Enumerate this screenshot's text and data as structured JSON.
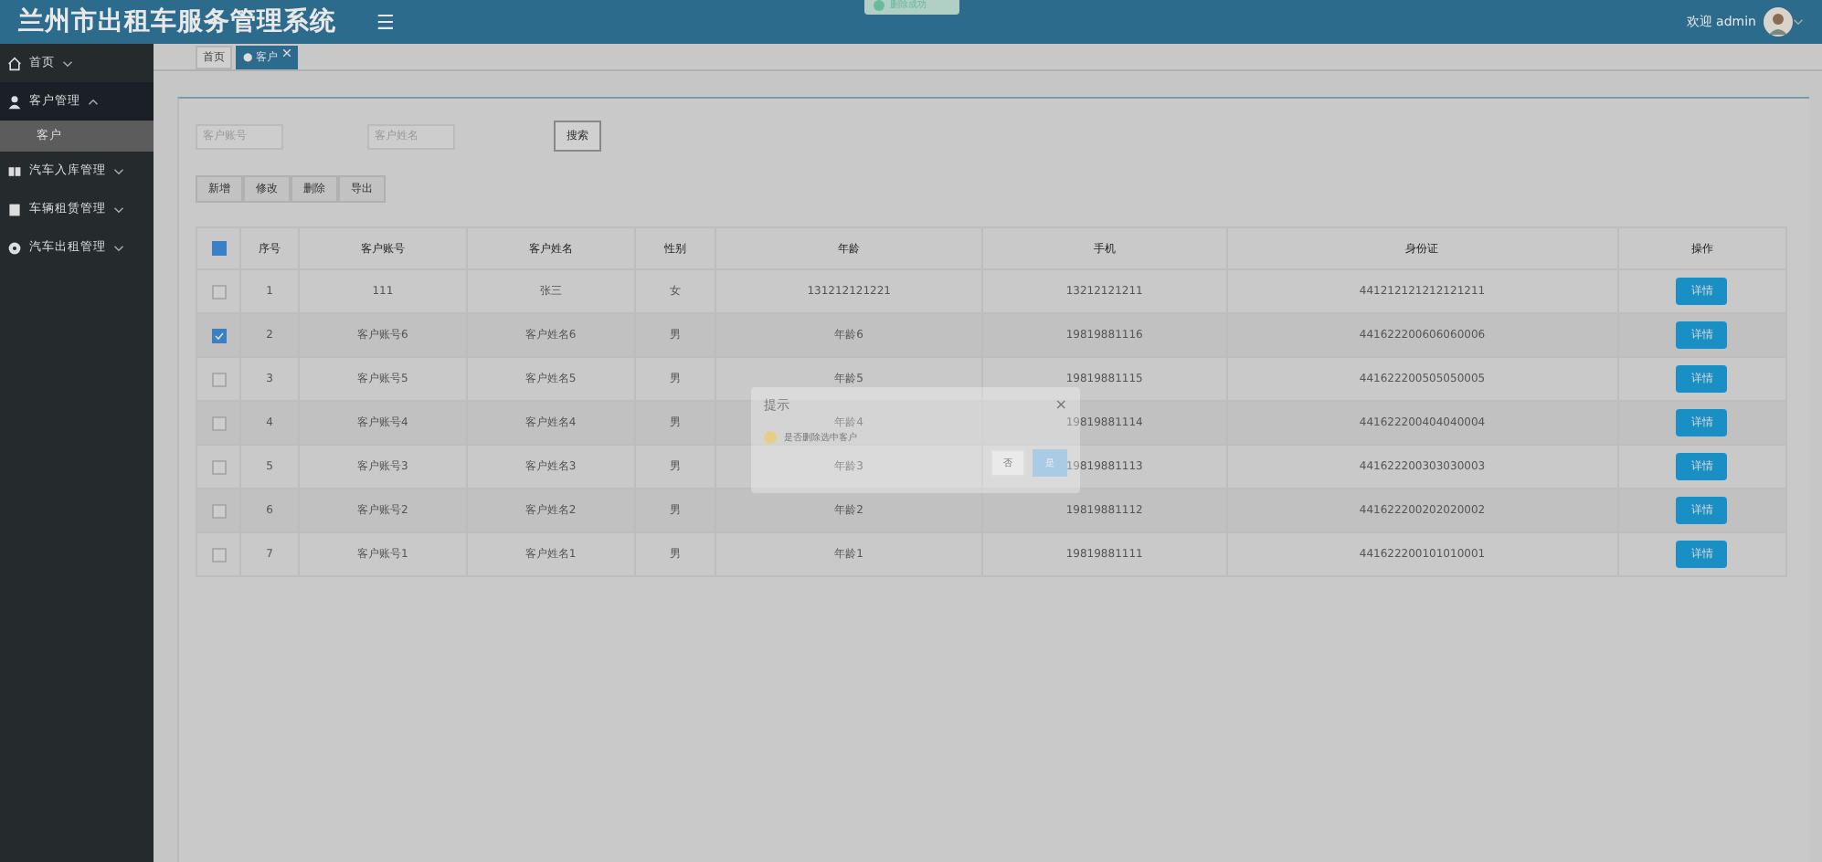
{
  "header": {
    "title": "兰州市出租车服务管理系统",
    "menu_toggle": "☰",
    "welcome": "欢迎 admin"
  },
  "toast": {
    "text": "删除成功"
  },
  "sidebar": {
    "items": [
      {
        "label": "首页",
        "expanded": false
      },
      {
        "label": "客户管理",
        "expanded": true,
        "children": [
          {
            "label": "客户",
            "selected": true
          }
        ]
      },
      {
        "label": "汽车入库管理",
        "expanded": false
      },
      {
        "label": "车辆租赁管理",
        "expanded": false
      },
      {
        "label": "汽车出租管理",
        "expanded": false
      }
    ]
  },
  "tabs": [
    {
      "label": "首页",
      "selected": false,
      "closable": false
    },
    {
      "label": "● 客户",
      "selected": true,
      "closable": true
    }
  ],
  "search": {
    "fields": [
      {
        "placeholder": "客户账号"
      },
      {
        "placeholder": "客户姓名"
      }
    ],
    "button": "搜索"
  },
  "toolbar": [
    "新增",
    "修改",
    "删除",
    "导出"
  ],
  "table": {
    "columns": [
      "序号",
      "客户账号",
      "客户姓名",
      "性别",
      "年龄",
      "手机",
      "身份证",
      "操作"
    ],
    "select_all_indeterminate": true,
    "rows": [
      {
        "checked": false,
        "cells": [
          "1",
          "111",
          "张三",
          "女",
          "131212121221",
          "13212121211",
          "441212121212121211"
        ],
        "action": "详情"
      },
      {
        "checked": true,
        "cells": [
          "2",
          "客户账号6",
          "客户姓名6",
          "男",
          "年龄6",
          "19819881116",
          "441622200606060006"
        ],
        "action": "详情"
      },
      {
        "checked": false,
        "cells": [
          "3",
          "客户账号5",
          "客户姓名5",
          "男",
          "年龄5",
          "19819881115",
          "441622200505050005"
        ],
        "action": "详情"
      },
      {
        "checked": false,
        "cells": [
          "4",
          "客户账号4",
          "客户姓名4",
          "男",
          "年龄4",
          "19819881114",
          "441622200404040004"
        ],
        "action": "详情"
      },
      {
        "checked": false,
        "cells": [
          "5",
          "客户账号3",
          "客户姓名3",
          "男",
          "年龄3",
          "19819881113",
          "441622200303030003"
        ],
        "action": "详情"
      },
      {
        "checked": false,
        "cells": [
          "6",
          "客户账号2",
          "客户姓名2",
          "男",
          "年龄2",
          "19819881112",
          "441622200202020002"
        ],
        "action": "详情"
      },
      {
        "checked": false,
        "cells": [
          "7",
          "客户账号1",
          "客户姓名1",
          "男",
          "年龄1",
          "19819881111",
          "441622200101010001"
        ],
        "action": "详情"
      }
    ]
  },
  "dialog": {
    "title": "提示",
    "close": "×",
    "message": "是否删除选中客户",
    "buttons": [
      {
        "label": "否",
        "primary": false
      },
      {
        "label": "是",
        "primary": true
      }
    ]
  }
}
